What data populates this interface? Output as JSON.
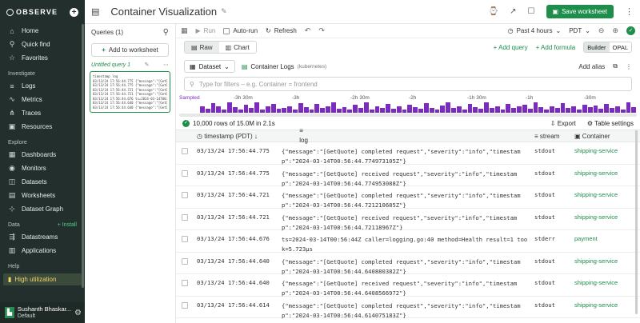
{
  "sidebar": {
    "logo": "OBSERVE",
    "top_items": [
      {
        "icon": "home-icon",
        "glyph": "⌂",
        "label": "Home"
      },
      {
        "icon": "search-icon",
        "glyph": "⚲",
        "label": "Quick find"
      },
      {
        "icon": "star-icon",
        "glyph": "☆",
        "label": "Favorites"
      }
    ],
    "investigate_label": "Investigate",
    "investigate_items": [
      {
        "icon": "logs-icon",
        "glyph": "≡",
        "label": "Logs"
      },
      {
        "icon": "metrics-icon",
        "glyph": "∿",
        "label": "Metrics"
      },
      {
        "icon": "traces-icon",
        "glyph": "⋔",
        "label": "Traces"
      },
      {
        "icon": "resources-icon",
        "glyph": "▣",
        "label": "Resources"
      }
    ],
    "explore_label": "Explore",
    "explore_items": [
      {
        "icon": "dashboards-icon",
        "glyph": "▦",
        "label": "Dashboards"
      },
      {
        "icon": "monitors-icon",
        "glyph": "◉",
        "label": "Monitors"
      },
      {
        "icon": "datasets-icon",
        "glyph": "◫",
        "label": "Datasets"
      },
      {
        "icon": "worksheets-icon",
        "glyph": "▤",
        "label": "Worksheets"
      },
      {
        "icon": "dataset-graph-icon",
        "glyph": "⊹",
        "label": "Dataset Graph"
      }
    ],
    "data_label": "Data",
    "install_label": "+ Install",
    "data_items": [
      {
        "icon": "datastreams-icon",
        "glyph": "⇶",
        "label": "Datastreams"
      },
      {
        "icon": "applications-icon",
        "glyph": "▥",
        "label": "Applications"
      }
    ],
    "help_label": "Help",
    "high_utilization": "High utilization",
    "user_name": "Sushanth Bhaskar...",
    "user_sub": "Default"
  },
  "topbar": {
    "title": "Container Visualization",
    "save_label": "Save worksheet"
  },
  "queries": {
    "header": "Queries (1)",
    "add_worksheet": "Add to worksheet",
    "query_name": "Untitled query 1",
    "thumb_lines": [
      "timestamp          log",
      "03/13/24 17:56:44.775 {\"message\":\"[GetQuote] comple",
      "03/13/24 17:56:44.775 {\"message\":\"[GetQuote] receiv",
      "03/13/24 17:56:44.721 {\"message\":\"[GetQuote] comple",
      "03/13/24 17:56:44.721 {\"message\":\"[GetQuote] receiv",
      "03/13/24 17:56:44.676 ts=2024-03-14T00:56:44Z caller",
      "03/13/24 17:56:44.640 {\"message\":\"[GetQuote] comple",
      "03/13/24 17:56:44.640 {\"message\":\"[GetQuote] receiv"
    ]
  },
  "toolbar": {
    "run": "Run",
    "autorun": "Auto-run",
    "refresh": "Refresh",
    "time_range": "Past 4 hours",
    "timezone": "PDT"
  },
  "mode_row": {
    "raw": "Raw",
    "chart": "Chart",
    "add_query": "+ Add query",
    "add_formula": "+ Add formula",
    "builder": "Builder",
    "opal": "OPAL"
  },
  "dataset_row": {
    "dataset": "Dataset",
    "dataset_name": "Container Logs",
    "dataset_kind": "(kubernetes)",
    "add_alias": "Add alias"
  },
  "filter": {
    "placeholder": "Type for filters – e.g. Container = frontend"
  },
  "histogram": {
    "sampled": "Sampled",
    "tick_labels": [
      "-3h 30m",
      "-3h",
      "-2h 30m",
      "-2h",
      "-1h 30m",
      "-1h",
      "-30m"
    ],
    "bar_levels": [
      0.55,
      0.35,
      0.85,
      0.6,
      0.3,
      0.9,
      0.5,
      0.25,
      0.7,
      0.4,
      0.95,
      0.3,
      0.55,
      0.8,
      0.35,
      0.45,
      0.6,
      0.3,
      0.85,
      0.5,
      0.25,
      0.75,
      0.4,
      0.6,
      0.9,
      0.35,
      0.5,
      0.3,
      0.7,
      0.45,
      0.95,
      0.3,
      0.55,
      0.4,
      0.8,
      0.35,
      0.6,
      0.25,
      0.7,
      0.5,
      0.35,
      0.85,
      0.45,
      0.3,
      0.65,
      0.9,
      0.4,
      0.55,
      0.3,
      0.75,
      0.5,
      0.35,
      0.95,
      0.45,
      0.6,
      0.3,
      0.8,
      0.4,
      0.55,
      0.7,
      0.35,
      0.9,
      0.5,
      0.3,
      0.6,
      0.45,
      0.85,
      0.4,
      0.55,
      0.3,
      0.7,
      0.5,
      0.65,
      0.35,
      0.8,
      0.45,
      0.6,
      0.3,
      0.9,
      0.5
    ]
  },
  "status": {
    "rows_text": "10,000 rows of 15.0M in 2.1s",
    "export": "Export",
    "table_settings": "Table settings"
  },
  "table": {
    "headers": {
      "timestamp": "timestamp (PDT)",
      "log": "log",
      "stream": "stream",
      "container": "Container"
    },
    "rows": [
      {
        "timestamp": "03/13/24 17:56:44.775",
        "log": "{\"message\":\"[GetQuote] completed request\",\"severity\":\"info\",\"timestamp\":\"2024-03-14T00:56:44.774973105Z\"}",
        "stream": "stdout",
        "container": "shipping-service"
      },
      {
        "timestamp": "03/13/24 17:56:44.775",
        "log": "{\"message\":\"[GetQuote] received request\",\"severity\":\"info\",\"timestamp\":\"2024-03-14T00:56:44.774953088Z\"}",
        "stream": "stdout",
        "container": "shipping-service"
      },
      {
        "timestamp": "03/13/24 17:56:44.721",
        "log": "{\"message\":\"[GetQuote] completed request\",\"severity\":\"info\",\"timestamp\":\"2024-03-14T00:56:44.721210685Z\"}",
        "stream": "stdout",
        "container": "shipping-service"
      },
      {
        "timestamp": "03/13/24 17:56:44.721",
        "log": "{\"message\":\"[GetQuote] received request\",\"severity\":\"info\",\"timestamp\":\"2024-03-14T00:56:44.72118967Z\"}",
        "stream": "stdout",
        "container": "shipping-service"
      },
      {
        "timestamp": "03/13/24 17:56:44.676",
        "log": "ts=2024-03-14T00:56:44Z caller=logging.go:40 method=Health result=1 took=5.723µs",
        "stream": "stderr",
        "container": "payment"
      },
      {
        "timestamp": "03/13/24 17:56:44.640",
        "log": "{\"message\":\"[GetQuote] completed request\",\"severity\":\"info\",\"timestamp\":\"2024-03-14T00:56:44.640880382Z\"}",
        "stream": "stdout",
        "container": "shipping-service"
      },
      {
        "timestamp": "03/13/24 17:56:44.640",
        "log": "{\"message\":\"[GetQuote] received request\",\"severity\":\"info\",\"timestamp\":\"2024-03-14T00:56:44.6408566972\"}",
        "stream": "stdout",
        "container": "shipping-service"
      },
      {
        "timestamp": "03/13/24 17:56:44.614",
        "log": "{\"message\":\"[GetQuote] completed request\",\"severity\":\"info\",\"timestamp\":\"2024-03-14T00:56:44.614075183Z\"}",
        "stream": "stdout",
        "container": "shipping-service"
      }
    ]
  },
  "colors": {
    "brand_green": "#1e8e4a",
    "histogram_purple": "#7b2cbf",
    "sidebar_bg": "#232f2c"
  }
}
